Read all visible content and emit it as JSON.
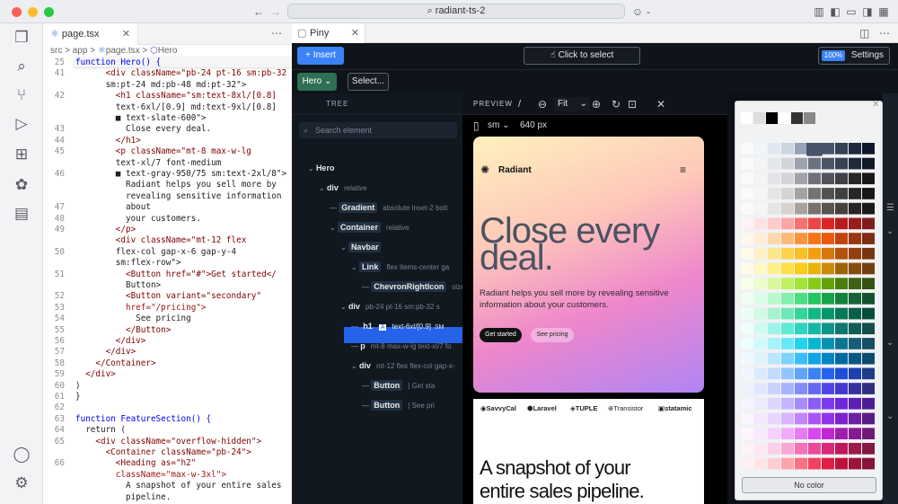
{
  "window": {
    "address": "radiant-ts-2"
  },
  "editor": {
    "tab": "page.tsx",
    "breadcrumb": [
      "src",
      ">",
      "app",
      ">",
      "page.tsx",
      ">",
      "Hero"
    ],
    "line_numbers": [
      "25",
      "41",
      "",
      "42",
      "",
      "",
      "43",
      "44",
      "45",
      "",
      "46",
      "",
      "",
      "47",
      "48",
      "49",
      "",
      "50",
      "",
      "51",
      "",
      "52",
      "53",
      "54",
      "55",
      "56",
      "57",
      "58",
      "59",
      "60",
      "61",
      "62",
      "63",
      "64",
      "65",
      "",
      "66",
      ""
    ],
    "lines": [
      "function Hero() {",
      "      <div className=\"pb-24 pt-16 sm:pb-32",
      "      sm:pt-24 md:pb-48 md:pt-32\">",
      "        <h1 className=\"sm:text-8xl/[0.8]",
      "        text-6xl/[0.9] md:text-9xl/[0.8]",
      "        ■ text-slate-600\">",
      "          Close every deal.",
      "        </h1>",
      "        <p className=\"mt-8 max-w-lg",
      "        text-xl/7 font-medium",
      "        ■ text-gray-950/75 sm:text-2xl/8\">",
      "          Radiant helps you sell more by",
      "          revealing sensitive information",
      "          about",
      "          your customers.",
      "        </p>",
      "        <div className=\"mt-12 flex",
      "        flex-col gap-x-6 gap-y-4",
      "        sm:flex-row\">",
      "          <Button href=\"#\">Get started</",
      "          Button>",
      "          <Button variant=\"secondary\"",
      "          href=\"/pricing\">",
      "            See pricing",
      "          </Button>",
      "        </div>",
      "      </div>",
      "    </Container>",
      "  </div>",
      ")",
      "}",
      "",
      "function FeatureSection() {",
      "  return (",
      "    <div className=\"overflow-hidden\">",
      "      <Container className=\"pb-24\">",
      "        <Heading as=\"h2\"",
      "        className=\"max-w-3xl\">",
      "          A snapshot of your entire sales",
      "          pipeline."
    ]
  },
  "piny": {
    "tab": "Piny",
    "insert": "+ Insert",
    "click_to_select": "Click to select",
    "zoom": "100%",
    "settings": "Settings",
    "hero_chip": "Hero",
    "select_chip": "Select...",
    "tree_label": "TREE",
    "search_placeholder": "Search element",
    "tree": [
      {
        "tag": "Hero",
        "cls": ""
      },
      {
        "tag": "div",
        "cls": "relative"
      },
      {
        "tag": "Gradient",
        "cls": "absolute inset-2 bott"
      },
      {
        "tag": "Container",
        "cls": "relative"
      },
      {
        "tag": "Navbar",
        "cls": ""
      },
      {
        "tag": "Link",
        "cls": "flex items-center ga"
      },
      {
        "tag": "ChevronRightIcon",
        "cls": "size"
      },
      {
        "tag": "div",
        "cls": "pb-24 pt-16 sm:pb-32 s"
      },
      {
        "tag": "h1",
        "cls": "text-6xl/[0.9]"
      },
      {
        "tag": "p",
        "cls": "mt-8 max-w-lg text-xl/7 fo"
      },
      {
        "tag": "div",
        "cls": "mt-12 flex flex-col gap-x-"
      },
      {
        "tag": "Button",
        "cls": "| Get sta"
      },
      {
        "tag": "Button",
        "cls": "| See pri"
      }
    ],
    "sm_badge": "SM",
    "preview_label": "PREVIEW",
    "preview_slash": "/",
    "fit": "Fit",
    "device": "sm",
    "width": "640 px",
    "site": {
      "brand": "Radiant",
      "headline_1": "Close every",
      "headline_2": "deal.",
      "sub": "Radiant helps you sell more by revealing sensitive information about your customers.",
      "cta_primary": "Get started",
      "cta_secondary": "See pricing",
      "logos": [
        "SavvyCal",
        "Laravel",
        "TUPLE",
        "Transistor",
        "statamic"
      ],
      "section_title": "A snapshot of your",
      "section_title_2": "entire sales pipeline."
    },
    "no_color": "No color"
  },
  "colors": {
    "accent": "#3b82f6",
    "selected": "#2563eb",
    "hero_chip": "#2f6f55"
  }
}
